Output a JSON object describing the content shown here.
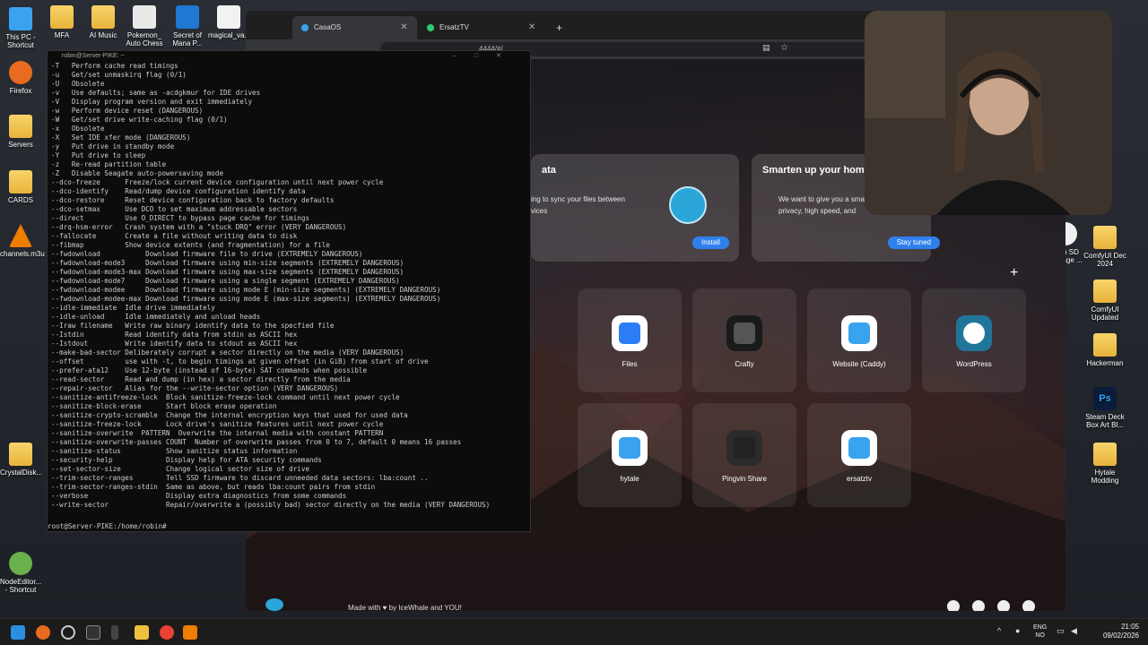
{
  "desktop_icons_left": [
    {
      "label": "This PC - Shortcut",
      "kind": "pc"
    },
    {
      "label": "Firefox",
      "kind": "firefox"
    },
    {
      "label": "Servers",
      "kind": "folder"
    },
    {
      "label": "CARDS",
      "kind": "folder"
    },
    {
      "label": "channels.m3u",
      "kind": "vlc"
    },
    {
      "label": "CrystalDisk...",
      "kind": "folder"
    },
    {
      "label": "NodeEditor... - Shortcut",
      "kind": "app"
    }
  ],
  "desktop_icons_top": [
    {
      "label": "MFA"
    },
    {
      "label": "AI Music"
    },
    {
      "label": "Pokemon_ Auto Chess"
    },
    {
      "label": "Secret of Mana P..."
    },
    {
      "label": "magical_va..."
    }
  ],
  "desktop_icons_right": [
    {
      "label": "elkin SD vantage ..."
    },
    {
      "label": "ComfyUI Dec 2024"
    },
    {
      "label": "ComfyUI Updated"
    },
    {
      "label": "Hackerman"
    },
    {
      "label": "Steam Deck Box Art Bl..."
    },
    {
      "label": "Hytale Modding"
    }
  ],
  "browser": {
    "tabs": [
      {
        "label": "CasaOS",
        "active": true
      },
      {
        "label": "ErsatzTV",
        "active": false
      }
    ],
    "url": "4444/#/",
    "new_tab": "+"
  },
  "casaos": {
    "cards": [
      {
        "title": "ata",
        "body": "ing to sync your files between vices",
        "button": "Install"
      },
      {
        "title": "Smarten up your home",
        "body": "We want to give you a sma with privacy, high speed, and",
        "button": "Stay tuned"
      }
    ],
    "add_symbol": "+",
    "apps": [
      {
        "label": "Files",
        "color": "#2d7df6"
      },
      {
        "label": "Crafty",
        "color": "#1a1a1a"
      },
      {
        "label": "Website (Caddy)",
        "color": "#3aa3f0"
      },
      {
        "label": "WordPress",
        "color": "#21759b"
      },
      {
        "label": "hytale",
        "color": "#3aa3f0"
      },
      {
        "label": "Pingvin Share",
        "color": "#222"
      },
      {
        "label": "ersatztv",
        "color": "#3aa3f0"
      }
    ],
    "footer": "Made with ♥ by IceWhale and YOU!"
  },
  "terminal": {
    "title": "robin@Server-PIKE: ~",
    "lines": [
      "-T   Perform cache read timings",
      "-u   Get/set unmaskirq flag (0/1)",
      "-U   Obsolete",
      "-v   Use defaults; same as -acdgkmur for IDE drives",
      "-V   Display program version and exit immediately",
      "-w   Perform device reset (DANGEROUS)",
      "-W   Get/set drive write-caching flag (0/1)",
      "-x   Obsolete",
      "-X   Set IDE xfer mode (DANGEROUS)",
      "-y   Put drive in standby mode",
      "-Y   Put drive to sleep",
      "-z   Re-read partition table",
      "-Z   Disable Seagate auto-powersaving mode",
      "--dco-freeze      Freeze/lock current device configuration until next power cycle",
      "--dco-identify    Read/dump device configuration identify data",
      "--dco-restore     Reset device configuration back to factory defaults",
      "--dco-setmax      Use DCO to set maximum addressable sectors",
      "--direct          Use O_DIRECT to bypass page cache for timings",
      "--drq-hsm-error   Crash system with a \"stuck DRQ\" error (VERY DANGEROUS)",
      "--fallocate       Create a file without writing data to disk",
      "--fibmap          Show device extents (and fragmentation) for a file",
      "--fwdownload           Download firmware file to drive (EXTREMELY DANGEROUS)",
      "--fwdownload-mode3     Download firmware using min-size segments (EXTREMELY DANGEROUS)",
      "--fwdownload-mode3-max Download firmware using max-size segments (EXTREMELY DANGEROUS)",
      "--fwdownload-mode7     Download firmware using a single segment (EXTREMELY DANGEROUS)",
      "--fwdownload-modee     Download firmware using mode E (min-size segments) (EXTREMELY DANGEROUS)",
      "--fwdownload-modee-max Download firmware using mode E (max-size segments) (EXTREMELY DANGEROUS)",
      "--idle-immediate  Idle drive immediately",
      "--idle-unload     Idle immediately and unload heads",
      "--Iraw filename   Write raw binary identify data to the specfied file",
      "--Istdin          Read identify data from stdin as ASCII hex",
      "--Istdout         Write identify data to stdout as ASCII hex",
      "--make-bad-sector Deliberately corrupt a sector directly on the media (VERY DANGEROUS)",
      "--offset          use with -t, to begin timings at given offset (in GiB) from start of drive",
      "--prefer-ata12    Use 12-byte (instead of 16-byte) SAT commands when possible",
      "--read-sector     Read and dump (in hex) a sector directly from the media",
      "--repair-sector   Alias for the --write-sector option (VERY DANGEROUS)",
      "--sanitize-antifreeze-lock  Block sanitize-freeze-lock command until next power cycle",
      "--sanitize-block-erase      Start block erase operation",
      "--sanitize-crypto-scramble  Change the internal encryption keys that used for used data",
      "--sanitize-freeze-lock      Lock drive's sanitize features until next power cycle",
      "--sanitize-overwrite  PATTERN  Overwrite the internal media with constant PATTERN",
      "--sanitize-overwrite-passes COUNT  Number of overwrite passes from 0 to 7, default 0 means 16 passes",
      "--sanitize-status           Show sanitize status information",
      "--security-help             Display help for ATA security commands",
      "--set-sector-size           Change logical sector size of drive",
      "--trim-sector-ranges        Tell SSD firmware to discard unneeded data sectors: lba:count ..",
      "--trim-sector-ranges-stdin  Same as above, but reads lba:count pairs from stdin",
      "--verbose                   Display extra diagnostics from some commands",
      "--write-sector              Repair/overwrite a (possibly bad) sector directly on the media (VERY DANGEROUS)"
    ],
    "prompt": "root@Server-PIKE:/home/robin#"
  },
  "taskbar": {
    "lang_top": "ENG",
    "lang_bottom": "NO",
    "time": "21:05",
    "date": "09/02/2026"
  }
}
